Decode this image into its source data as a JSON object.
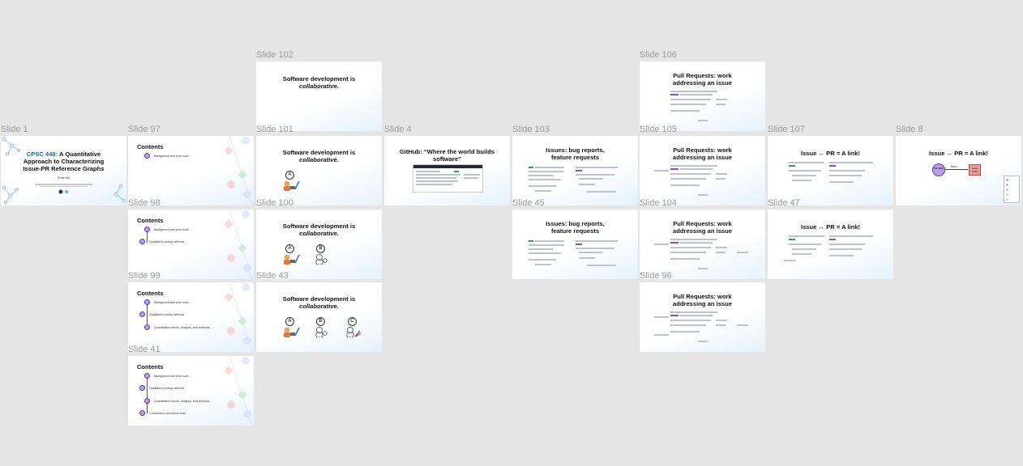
{
  "slides": [
    {
      "id": "s1",
      "label": "Slide 1",
      "title_accent": "CPSC 448:",
      "title_rest": " A Quantitative Approach to Characterizing Issue-PR Reference Graphs",
      "author": "Emile Ma"
    },
    {
      "id": "s97",
      "label": "Slide 97",
      "heading": "Contents",
      "items": [
        "Background and prior work"
      ]
    },
    {
      "id": "s98",
      "label": "Slide 98",
      "heading": "Contents",
      "items": [
        "Background and prior work",
        "Qualitative coding methods"
      ]
    },
    {
      "id": "s99",
      "label": "Slide 99",
      "heading": "Contents",
      "items": [
        "Background and prior work",
        "Qualitative coding methods",
        "Quantitative results, analysis, and methods"
      ]
    },
    {
      "id": "s41",
      "label": "Slide 41",
      "heading": "Contents",
      "items": [
        "Background and prior work",
        "Qualitative coding methods",
        "Quantitative results, analysis, and methods",
        "Conclusions and future work"
      ]
    },
    {
      "id": "s102",
      "label": "Slide 102",
      "title_a": "Software development is",
      "title_b": "collaborative."
    },
    {
      "id": "s101",
      "label": "Slide 101",
      "title_a": "Software development is",
      "title_b": "collaborative.",
      "people": [
        "A"
      ]
    },
    {
      "id": "s100",
      "label": "Slide 100",
      "title_a": "Software development is",
      "title_b": "collaborative.",
      "people": [
        "A",
        "B"
      ]
    },
    {
      "id": "s43",
      "label": "Slide 43",
      "title_a": "Software development is",
      "title_b": "collaborative.",
      "people": [
        "A",
        "B",
        "C"
      ]
    },
    {
      "id": "s4",
      "label": "Slide 4",
      "title": "GitHub: “Where the world builds software”"
    },
    {
      "id": "s103",
      "label": "Slide 103",
      "title": "Issues: bug reports, feature requests"
    },
    {
      "id": "s45",
      "label": "Slide 45",
      "title": "Issues: bug reports, feature requests"
    },
    {
      "id": "s106",
      "label": "Slide 106",
      "title": "Pull Requests: work addressing an issue"
    },
    {
      "id": "s105",
      "label": "Slide 105",
      "title": "Pull Requests: work addressing an issue"
    },
    {
      "id": "s104",
      "label": "Slide 104",
      "title": "Pull Requests: work addressing an issue"
    },
    {
      "id": "s96",
      "label": "Slide 96",
      "title": "Pull Requests: work addressing an issue"
    },
    {
      "id": "s107",
      "label": "Slide 107",
      "title": "Issue ↔ PR = A link!"
    },
    {
      "id": "s47",
      "label": "Slide 47",
      "title": "Issue ↔ PR = A link!"
    },
    {
      "id": "s8",
      "label": "Slide 8",
      "title": "Issue ↔ PR = A link!",
      "node_left": "PR #456",
      "node_right": "Issue #123",
      "edge": "fixes"
    }
  ],
  "colors": {
    "canvas": "#e5e5e5",
    "label": "#9a9a9a",
    "accent": "#1b6aa5",
    "node_purple": "#b9a0e6",
    "node_red": "#f19b9b"
  }
}
